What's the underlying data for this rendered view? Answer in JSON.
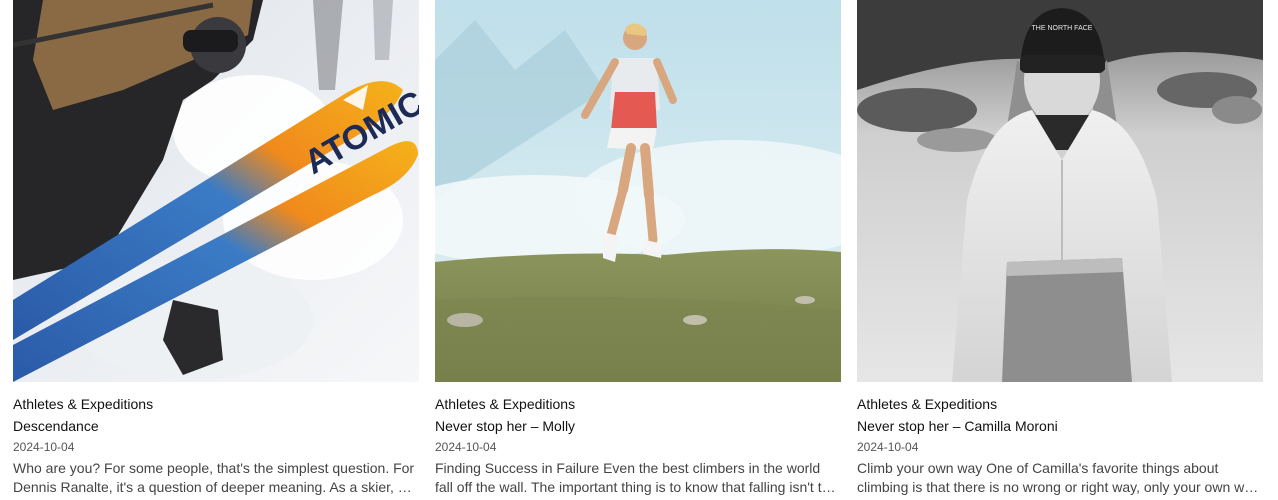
{
  "cards": [
    {
      "category": "Athletes & Expeditions",
      "title": "Descendance",
      "date": "2024-10-04",
      "excerpt": "Who are you? For some people, that's the simplest question. For Dennis Ranalte, it's a question of deeper meaning. As a skier, he has always asked himself who he is and what defines him.",
      "image": {
        "subject": "skier-with-atomic-skis-in-powder",
        "ski_brand_text": "ATOMIC"
      }
    },
    {
      "category": "Athletes & Expeditions",
      "title": "Never stop her – Molly",
      "date": "2024-10-04",
      "excerpt": "Finding Success in Failure Even the best climbers in the world fall off the wall. The important thing is to know that falling isn't the end of the story.",
      "image": {
        "subject": "trail-runner-on-mountain-meadow"
      }
    },
    {
      "category": "Athletes & Expeditions",
      "title": "Never stop her – Camilla Moroni",
      "date": "2024-10-04",
      "excerpt": "Climb your own way One of Camilla's favorite things about climbing is that there is no wrong or right way, only your own way to climb.",
      "image": {
        "subject": "woman-in-beanie-and-jacket-black-and-white",
        "beanie_logo": "THE NORTH FACE"
      }
    }
  ]
}
